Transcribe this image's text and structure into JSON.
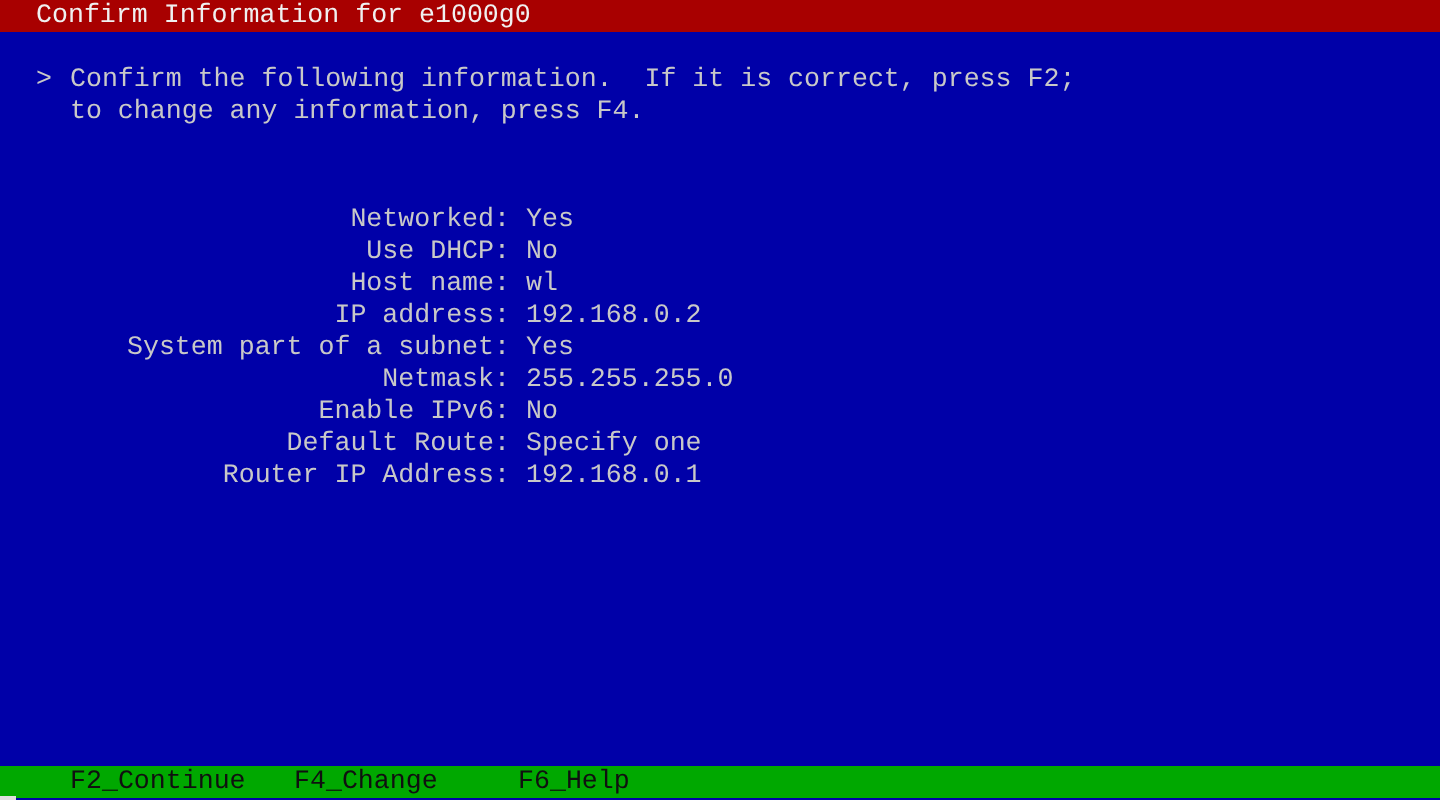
{
  "window": {
    "title": "Confirm Information for e1000g0"
  },
  "prompt": {
    "marker": ">",
    "message": "Confirm the following information.  If it is correct, press F2;\nto change any information, press F4."
  },
  "fields": [
    {
      "label": "Networked:",
      "value": "Yes"
    },
    {
      "label": "Use DHCP:",
      "value": "No"
    },
    {
      "label": "Host name:",
      "value": "wl"
    },
    {
      "label": "IP address:",
      "value": "192.168.0.2"
    },
    {
      "label": "System part of a subnet:",
      "value": "Yes"
    },
    {
      "label": "Netmask:",
      "value": "255.255.255.0"
    },
    {
      "label": "Enable IPv6:",
      "value": "No"
    },
    {
      "label": "Default Route:",
      "value": "Specify one"
    },
    {
      "label": "Router IP Address:",
      "value": "192.168.0.1"
    }
  ],
  "function_keys": [
    "F2_Continue",
    "F4_Change",
    "F6_Help"
  ]
}
